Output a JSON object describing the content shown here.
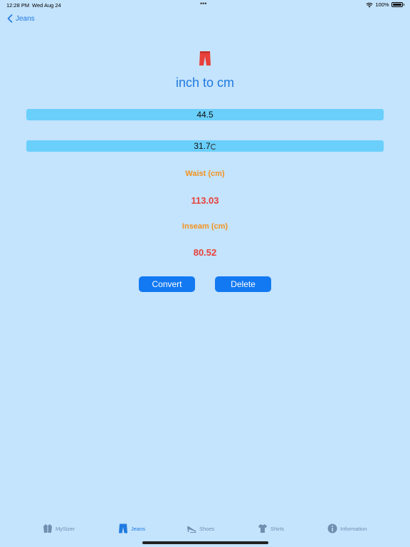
{
  "status_bar": {
    "time": "12:28 PM",
    "date": "Wed Aug 24",
    "battery": "100%"
  },
  "nav": {
    "back_label": "Jeans"
  },
  "header": {
    "title": "inch to cm",
    "icon": "jeans-icon"
  },
  "inputs": {
    "waist_value": "44.5",
    "inseam_value": "31.7"
  },
  "results": {
    "waist_label": "Waist (cm)",
    "waist_value": "113.03",
    "inseam_label": "Inseam (cm)",
    "inseam_value": "80.52"
  },
  "buttons": {
    "convert": "Convert",
    "delete": "Delete"
  },
  "tabs": [
    {
      "label": "MySizer",
      "icon": "jacket-icon",
      "active": false
    },
    {
      "label": "Jeans",
      "icon": "jeans-icon",
      "active": true
    },
    {
      "label": "Shoes",
      "icon": "shoe-icon",
      "active": false
    },
    {
      "label": "Shirts",
      "icon": "shirt-icon",
      "active": false
    },
    {
      "label": "Information",
      "icon": "info-icon",
      "active": false
    }
  ],
  "colors": {
    "background": "#c4e3fd",
    "accent": "#1f7ae0",
    "field": "#6acffb",
    "label_orange": "#f2931e",
    "result_red": "#e8403a",
    "button": "#1379f2"
  }
}
